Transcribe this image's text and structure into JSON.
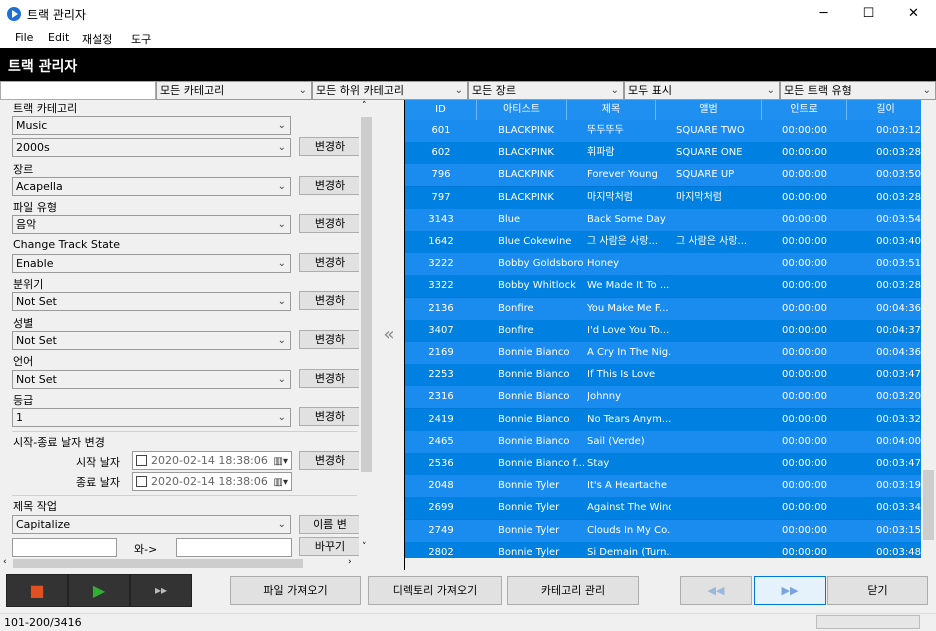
{
  "window": {
    "title": "트랙 관리자",
    "minimize": "─",
    "maximize": "☐",
    "close": "✕"
  },
  "menu": [
    "File",
    "Edit",
    "재설정",
    "도구"
  ],
  "header": {
    "title": "트랙 관리자"
  },
  "filters": [
    "모든 카테고리",
    "모든 하위 카테고리",
    "모든 장르",
    "모두 표시",
    "모든 트랙 유형"
  ],
  "left": {
    "track_category_label": "트랙 카테고리",
    "category_value": "Music",
    "subcategory_value": "2000s",
    "genre_label": "장르",
    "genre_value": "Acapella",
    "filetype_label": "파일 유형",
    "filetype_value": "음악",
    "state_label": "Change Track State",
    "state_value": "Enable",
    "mood_label": "분위기",
    "mood_value": "Not Set",
    "gender_label": "성별",
    "gender_value": "Not Set",
    "language_label": "언어",
    "language_value": "Not Set",
    "grade_label": "등급",
    "grade_value": "1",
    "change_button": "변경하",
    "date_section_label": "시작-종료 날자 변경",
    "start_label": "시작 날자",
    "start_value": "2020-02-14 18:38:06",
    "end_label": "종료 날자",
    "end_value": "2020-02-14 18:38:06",
    "title_section_label": "제목 작업",
    "title_op_value": "Capitalize",
    "rename_button": "이름 변",
    "with_label": "와->",
    "replace_button": "바꾸기"
  },
  "grid": {
    "columns": [
      "ID",
      "아티스트",
      "제목",
      "앨범",
      "인트로",
      "길이"
    ],
    "rows": [
      [
        "601",
        "BLACKPINK",
        "뚜두뚜두",
        "SQUARE TWO",
        "00:00:00",
        "00:03:12"
      ],
      [
        "602",
        "BLACKPINK",
        "휘파람",
        "SQUARE ONE",
        "00:00:00",
        "00:03:28"
      ],
      [
        "796",
        "BLACKPINK",
        "Forever Young",
        "SQUARE UP",
        "00:00:00",
        "00:03:50"
      ],
      [
        "797",
        "BLACKPINK",
        "마지막처럼",
        "마지막처럼",
        "00:00:00",
        "00:03:28"
      ],
      [
        "3143",
        "Blue",
        "Back Some Day",
        "",
        "00:00:00",
        "00:03:54"
      ],
      [
        "1642",
        "Blue Cokewine",
        "그 사람은 사랑...",
        "그 사람은 사랑...",
        "00:00:00",
        "00:03:40"
      ],
      [
        "3222",
        "Bobby Goldsboro",
        "Honey",
        "",
        "00:00:00",
        "00:03:51"
      ],
      [
        "3322",
        "Bobby Whitlock",
        "We Made It To ...",
        "",
        "00:00:00",
        "00:03:28"
      ],
      [
        "2136",
        "Bonfire",
        "You Make Me F...",
        "",
        "00:00:00",
        "00:04:36"
      ],
      [
        "3407",
        "Bonfire",
        "I'd Love You To...",
        "",
        "00:00:00",
        "00:04:37"
      ],
      [
        "2169",
        "Bonnie Bianco",
        "A Cry In The Nig...",
        "",
        "00:00:00",
        "00:04:36"
      ],
      [
        "2253",
        "Bonnie Bianco",
        "If This Is Love",
        "",
        "00:00:00",
        "00:03:47"
      ],
      [
        "2316",
        "Bonnie Bianco",
        "Johnny",
        "",
        "00:00:00",
        "00:03:20"
      ],
      [
        "2419",
        "Bonnie Bianco",
        "No Tears Anym...",
        "",
        "00:00:00",
        "00:03:32"
      ],
      [
        "2465",
        "Bonnie Bianco",
        "Sail (Verde)",
        "",
        "00:00:00",
        "00:04:00"
      ],
      [
        "2536",
        "Bonnie Bianco f...",
        "Stay",
        "",
        "00:00:00",
        "00:03:47"
      ],
      [
        "2048",
        "Bonnie Tyler",
        "It's A Heartache",
        "",
        "00:00:00",
        "00:03:19"
      ],
      [
        "2699",
        "Bonnie Tyler",
        "Against The Wind",
        "",
        "00:00:00",
        "00:03:34"
      ],
      [
        "2749",
        "Bonnie Tyler",
        "Clouds In My Co...",
        "",
        "00:00:00",
        "00:03:15"
      ],
      [
        "2802",
        "Bonnie Tyler",
        "Si Demain (Turn...",
        "",
        "00:00:00",
        "00:03:48"
      ]
    ]
  },
  "bottom": {
    "stop_icon": "■",
    "play_icon": "▶",
    "forward_icon": "▸▸",
    "import_file": "파일 가져오기",
    "import_dir": "디렉토리 가져오기",
    "manage_category": "카테고리 관리",
    "prev_icon": "◀◀",
    "next_icon": "▶▶",
    "close": "닫기"
  },
  "status": {
    "text": "101-200/3416"
  },
  "colors": {
    "grid_bg": "#0078d7",
    "header_bg": "#000000",
    "stop": "#e05020",
    "play": "#30b030"
  }
}
